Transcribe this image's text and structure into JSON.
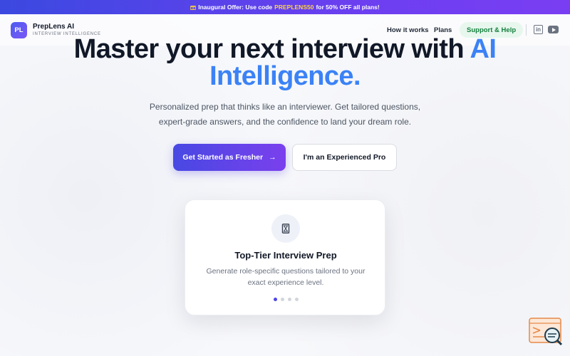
{
  "promo": {
    "icon": "gift-icon",
    "prefix": "Inaugural Offer: Use code",
    "code": "PREPLENS50",
    "suffix": "for 50% OFF all plans!"
  },
  "brand": {
    "logo": "PL",
    "name": "PrepLens AI",
    "tagline": "INTERVIEW INTELLIGENCE"
  },
  "nav": {
    "how": "How it works",
    "plans": "Plans",
    "support": "Support & Help",
    "linkedin": "in"
  },
  "hero": {
    "line1": "Master your next interview with",
    "line1_accent": "AI",
    "line2": "Intelligence",
    "line2_end": "."
  },
  "subtitle": "Personalized prep that thinks like an interviewer. Get tailored questions, expert-grade answers, and the confidence to land your dream role.",
  "buttons": {
    "primary": "Get Started as Fresher",
    "primary_arrow": "→",
    "secondary": "I'm an Experienced Pro"
  },
  "card": {
    "icon": "hourglass-icon",
    "title": "Top-Tier Interview Prep",
    "desc": "Generate role-specific questions tailored to your exact experience level.",
    "slides": 4,
    "active_slide": 1
  },
  "colors": {
    "primary": "#4848e3",
    "accent": "#3b82f6",
    "promo_code": "#ffd43b",
    "support_bg": "#e7f7ee",
    "support_text": "#15803d"
  }
}
